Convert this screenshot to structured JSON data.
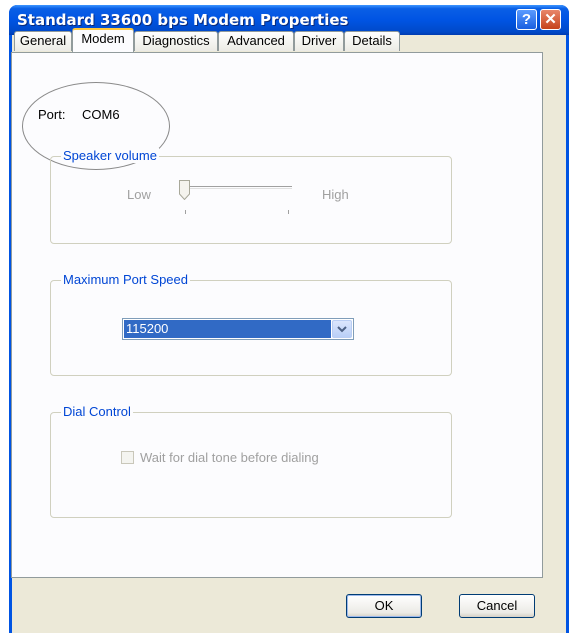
{
  "window": {
    "title": "Standard 33600 bps Modem Properties"
  },
  "titlebar_buttons": {
    "help": "?",
    "close": "✕"
  },
  "tabs": [
    {
      "label": "General"
    },
    {
      "label": "Modem"
    },
    {
      "label": "Diagnostics"
    },
    {
      "label": "Advanced"
    },
    {
      "label": "Driver"
    },
    {
      "label": "Details"
    }
  ],
  "active_tab": "Modem",
  "port": {
    "label": "Port:",
    "value": "COM6"
  },
  "speaker_volume": {
    "title": "Speaker volume",
    "low": "Low",
    "high": "High",
    "level": 0
  },
  "max_port_speed": {
    "title": "Maximum Port Speed",
    "selected": "115200"
  },
  "dial_control": {
    "title": "Dial Control",
    "checkbox_label": "Wait for dial tone before dialing",
    "checked": false
  },
  "buttons": {
    "ok": "OK",
    "cancel": "Cancel"
  }
}
